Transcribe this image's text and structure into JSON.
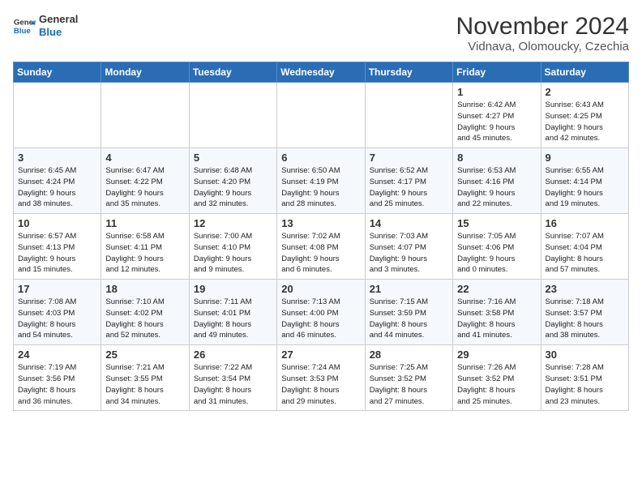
{
  "header": {
    "logo_line1": "General",
    "logo_line2": "Blue",
    "month": "November 2024",
    "location": "Vidnava, Olomoucky, Czechia"
  },
  "weekdays": [
    "Sunday",
    "Monday",
    "Tuesday",
    "Wednesday",
    "Thursday",
    "Friday",
    "Saturday"
  ],
  "weeks": [
    [
      {
        "day": "",
        "info": ""
      },
      {
        "day": "",
        "info": ""
      },
      {
        "day": "",
        "info": ""
      },
      {
        "day": "",
        "info": ""
      },
      {
        "day": "",
        "info": ""
      },
      {
        "day": "1",
        "info": "Sunrise: 6:42 AM\nSunset: 4:27 PM\nDaylight: 9 hours\nand 45 minutes."
      },
      {
        "day": "2",
        "info": "Sunrise: 6:43 AM\nSunset: 4:25 PM\nDaylight: 9 hours\nand 42 minutes."
      }
    ],
    [
      {
        "day": "3",
        "info": "Sunrise: 6:45 AM\nSunset: 4:24 PM\nDaylight: 9 hours\nand 38 minutes."
      },
      {
        "day": "4",
        "info": "Sunrise: 6:47 AM\nSunset: 4:22 PM\nDaylight: 9 hours\nand 35 minutes."
      },
      {
        "day": "5",
        "info": "Sunrise: 6:48 AM\nSunset: 4:20 PM\nDaylight: 9 hours\nand 32 minutes."
      },
      {
        "day": "6",
        "info": "Sunrise: 6:50 AM\nSunset: 4:19 PM\nDaylight: 9 hours\nand 28 minutes."
      },
      {
        "day": "7",
        "info": "Sunrise: 6:52 AM\nSunset: 4:17 PM\nDaylight: 9 hours\nand 25 minutes."
      },
      {
        "day": "8",
        "info": "Sunrise: 6:53 AM\nSunset: 4:16 PM\nDaylight: 9 hours\nand 22 minutes."
      },
      {
        "day": "9",
        "info": "Sunrise: 6:55 AM\nSunset: 4:14 PM\nDaylight: 9 hours\nand 19 minutes."
      }
    ],
    [
      {
        "day": "10",
        "info": "Sunrise: 6:57 AM\nSunset: 4:13 PM\nDaylight: 9 hours\nand 15 minutes."
      },
      {
        "day": "11",
        "info": "Sunrise: 6:58 AM\nSunset: 4:11 PM\nDaylight: 9 hours\nand 12 minutes."
      },
      {
        "day": "12",
        "info": "Sunrise: 7:00 AM\nSunset: 4:10 PM\nDaylight: 9 hours\nand 9 minutes."
      },
      {
        "day": "13",
        "info": "Sunrise: 7:02 AM\nSunset: 4:08 PM\nDaylight: 9 hours\nand 6 minutes."
      },
      {
        "day": "14",
        "info": "Sunrise: 7:03 AM\nSunset: 4:07 PM\nDaylight: 9 hours\nand 3 minutes."
      },
      {
        "day": "15",
        "info": "Sunrise: 7:05 AM\nSunset: 4:06 PM\nDaylight: 9 hours\nand 0 minutes."
      },
      {
        "day": "16",
        "info": "Sunrise: 7:07 AM\nSunset: 4:04 PM\nDaylight: 8 hours\nand 57 minutes."
      }
    ],
    [
      {
        "day": "17",
        "info": "Sunrise: 7:08 AM\nSunset: 4:03 PM\nDaylight: 8 hours\nand 54 minutes."
      },
      {
        "day": "18",
        "info": "Sunrise: 7:10 AM\nSunset: 4:02 PM\nDaylight: 8 hours\nand 52 minutes."
      },
      {
        "day": "19",
        "info": "Sunrise: 7:11 AM\nSunset: 4:01 PM\nDaylight: 8 hours\nand 49 minutes."
      },
      {
        "day": "20",
        "info": "Sunrise: 7:13 AM\nSunset: 4:00 PM\nDaylight: 8 hours\nand 46 minutes."
      },
      {
        "day": "21",
        "info": "Sunrise: 7:15 AM\nSunset: 3:59 PM\nDaylight: 8 hours\nand 44 minutes."
      },
      {
        "day": "22",
        "info": "Sunrise: 7:16 AM\nSunset: 3:58 PM\nDaylight: 8 hours\nand 41 minutes."
      },
      {
        "day": "23",
        "info": "Sunrise: 7:18 AM\nSunset: 3:57 PM\nDaylight: 8 hours\nand 38 minutes."
      }
    ],
    [
      {
        "day": "24",
        "info": "Sunrise: 7:19 AM\nSunset: 3:56 PM\nDaylight: 8 hours\nand 36 minutes."
      },
      {
        "day": "25",
        "info": "Sunrise: 7:21 AM\nSunset: 3:55 PM\nDaylight: 8 hours\nand 34 minutes."
      },
      {
        "day": "26",
        "info": "Sunrise: 7:22 AM\nSunset: 3:54 PM\nDaylight: 8 hours\nand 31 minutes."
      },
      {
        "day": "27",
        "info": "Sunrise: 7:24 AM\nSunset: 3:53 PM\nDaylight: 8 hours\nand 29 minutes."
      },
      {
        "day": "28",
        "info": "Sunrise: 7:25 AM\nSunset: 3:52 PM\nDaylight: 8 hours\nand 27 minutes."
      },
      {
        "day": "29",
        "info": "Sunrise: 7:26 AM\nSunset: 3:52 PM\nDaylight: 8 hours\nand 25 minutes."
      },
      {
        "day": "30",
        "info": "Sunrise: 7:28 AM\nSunset: 3:51 PM\nDaylight: 8 hours\nand 23 minutes."
      }
    ]
  ]
}
